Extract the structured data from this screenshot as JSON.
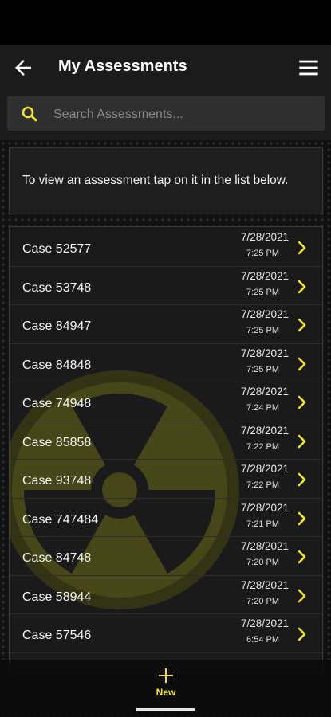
{
  "header": {
    "title": "My Assessments",
    "back_icon": "arrow-left-icon",
    "menu_icon": "hamburger-menu-icon"
  },
  "search": {
    "placeholder": "Search Assessments...",
    "value": ""
  },
  "info_text": "To view an assessment tap on it in the list below.",
  "assessments": [
    {
      "name": "Case 52577",
      "date": "7/28/2021",
      "time": "7:25 PM"
    },
    {
      "name": "Case 53748",
      "date": "7/28/2021",
      "time": "7:25 PM"
    },
    {
      "name": "Case 84947",
      "date": "7/28/2021",
      "time": "7:25 PM"
    },
    {
      "name": "Case 84848",
      "date": "7/28/2021",
      "time": "7:25 PM"
    },
    {
      "name": "Case 74948",
      "date": "7/28/2021",
      "time": "7:24 PM"
    },
    {
      "name": "Case 85858",
      "date": "7/28/2021",
      "time": "7:22 PM"
    },
    {
      "name": "Case 93748",
      "date": "7/28/2021",
      "time": "7:22 PM"
    },
    {
      "name": "Case 747484",
      "date": "7/28/2021",
      "time": "7:21 PM"
    },
    {
      "name": "Case 84748",
      "date": "7/28/2021",
      "time": "7:20 PM"
    },
    {
      "name": "Case 58944",
      "date": "7/28/2021",
      "time": "7:20 PM"
    },
    {
      "name": "Case 57546",
      "date": "7/28/2021",
      "time": "6:54 PM"
    }
  ],
  "bottom_nav": {
    "new_label": "New"
  },
  "colors": {
    "accent": "#f2e52b",
    "appbar": "#1b1b1b",
    "background": "#111111"
  }
}
